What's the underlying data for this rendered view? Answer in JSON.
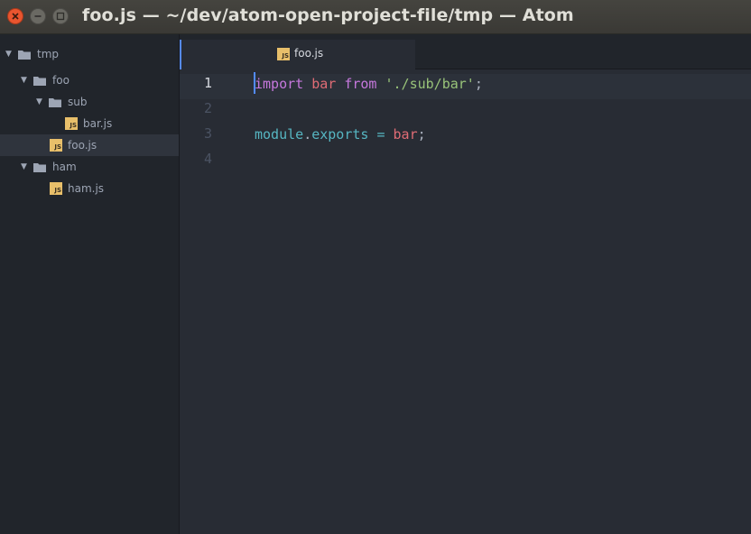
{
  "window": {
    "title": "foo.js — ~/dev/atom-open-project-file/tmp — Atom"
  },
  "tree": {
    "root": {
      "label": "tmp"
    },
    "items": [
      {
        "label": "foo"
      },
      {
        "label": "sub"
      },
      {
        "label": "bar.js"
      },
      {
        "label": "foo.js"
      },
      {
        "label": "ham"
      },
      {
        "label": "ham.js"
      }
    ],
    "file_icon_text": "JS"
  },
  "tabs": [
    {
      "label": "foo.js"
    }
  ],
  "editor": {
    "line_numbers": [
      "1",
      "2",
      "3",
      "4"
    ],
    "line1": {
      "t1": "import",
      "t2": " ",
      "t3": "bar",
      "t4": " ",
      "t5": "from",
      "t6": " ",
      "t7": "'./sub/bar'",
      "t8": ";"
    },
    "line3": {
      "t1": "module",
      "t2": ".",
      "t3": "exports",
      "t4": " = ",
      "t5": "bar",
      "t6": ";"
    }
  },
  "colors": {
    "keyword": "#c678dd",
    "variable": "#e06c75",
    "string": "#98c379",
    "module": "#56b6c2",
    "close_button": "#e9552f",
    "js_icon": "#e8bf6a"
  }
}
